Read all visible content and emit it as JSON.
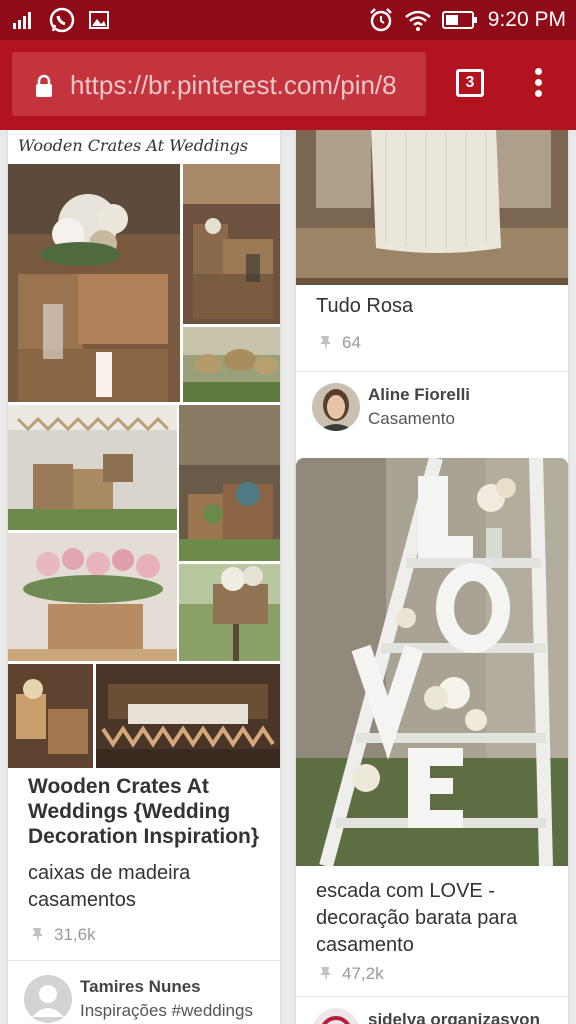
{
  "status_bar": {
    "time": "9:20 PM",
    "left_icons": [
      "signal-icon",
      "whatsapp-icon",
      "gallery-icon"
    ],
    "right_icons": [
      "alarm-icon",
      "wifi-icon",
      "battery-icon"
    ]
  },
  "browser": {
    "url": "https://br.pinterest.com/pin/8",
    "tab_count": "3",
    "toolbar_color": "#b3121f",
    "statusbar_color": "#8e0b17"
  },
  "pins": {
    "left": {
      "collage_title": "Wooden Crates At Weddings",
      "title": "Wooden Crates At Weddings {Wedding Decoration Inspiration}",
      "description": "caixas de madeira casamentos",
      "saves": "31,6k",
      "user": {
        "name": "Tamires Nunes",
        "board": "Inspirações #weddings"
      }
    },
    "right_top": {
      "title": "Tudo Rosa",
      "saves": "64",
      "user": {
        "name": "Aline Fiorelli",
        "board": "Casamento"
      }
    },
    "right_bottom": {
      "description": "escada com LOVE - decoração barata para casamento",
      "saves": "47,2k",
      "user": {
        "name": "sidelya organizasyon"
      }
    }
  }
}
